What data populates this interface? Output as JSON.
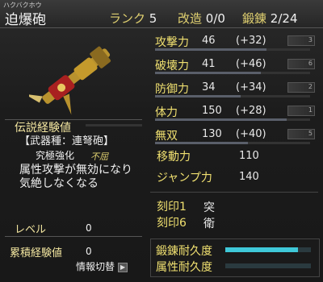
{
  "header": {
    "furigana": "ハクバクホウ",
    "weapon_name": "迫爆砲",
    "rank_label": "ランク",
    "rank_value": "5",
    "modify_label": "改造",
    "modify_value": "0/0",
    "forge_label": "鍛錬",
    "forge_value": "2/24"
  },
  "left": {
    "legend_exp_label": "伝説経験値",
    "weapon_type": "【武器種：連弩砲】",
    "ultimate_label": "究極強化",
    "ultimate_tag": "不屈",
    "description_line1": "属性攻撃が無効になり",
    "description_line2": "気絶しなくなる",
    "level_label": "レベル",
    "level_value": "0",
    "total_exp_label": "累積経験値",
    "total_exp_value": "0",
    "info_toggle_label": "情報切替",
    "info_toggle_icon": "▶"
  },
  "stats": [
    {
      "name": "攻撃力",
      "value": "46",
      "bonus": "(+32)",
      "slot": "3",
      "fill": 0.72
    },
    {
      "name": "破壊力",
      "value": "41",
      "bonus": "(+46)",
      "slot": "6",
      "fill": 0.68
    },
    {
      "name": "防御力",
      "value": "34",
      "bonus": "(+34)",
      "slot": "2",
      "fill": 0.55
    },
    {
      "name": "体力",
      "value": "150",
      "bonus": "(+28)",
      "slot": "1",
      "fill": 0.85
    },
    {
      "name": "無双",
      "value": "130",
      "bonus": "(+40)",
      "slot": "5",
      "fill": 0.6
    }
  ],
  "extra": {
    "move_label": "移動力",
    "move_value": "110",
    "jump_label": "ジャンプ力",
    "jump_value": "140"
  },
  "seals": [
    {
      "label": "刻印1",
      "value": "突"
    },
    {
      "label": "刻印6",
      "value": "衛"
    }
  ],
  "durability": {
    "forge_label": "鍛錬耐久度",
    "forge_fill": 0.85,
    "attr_label": "属性耐久度",
    "attr_fill": 0.0
  },
  "colors": {
    "accent_label": "#f0e070",
    "durability_bar": "#3fc8d8"
  }
}
